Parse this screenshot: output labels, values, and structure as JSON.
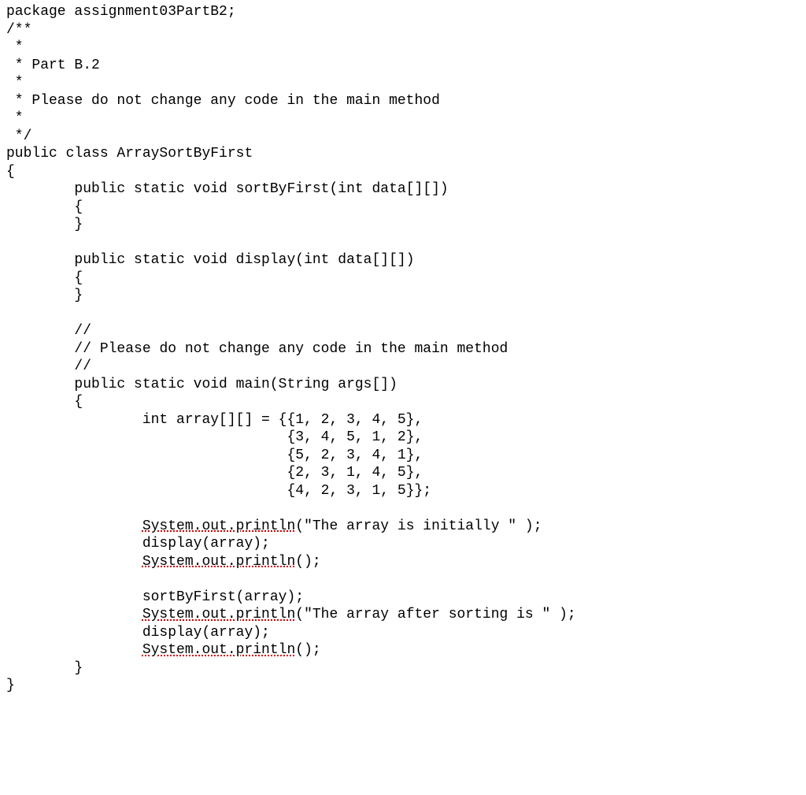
{
  "code": {
    "package_line": "package assignment03PartB2;",
    "javadoc_open": "/**",
    "star": " *",
    "part_line": " * Part B.2",
    "note_line": " * Please do not change any code in the main method",
    "javadoc_close": " */",
    "class_decl": "public class ArraySortByFirst",
    "brace_open": "{",
    "brace_close": "}",
    "indent1": "        ",
    "indent2": "                ",
    "indent_array": "                                 ",
    "sortByFirst_sig": "public static void sortByFirst(int data[][])",
    "display_sig": "public static void display(int data[][])",
    "comment_slashes": "//",
    "main_note": "// Please do not change any code in the main method",
    "main_sig": "public static void main(String args[])",
    "arr_l1": "int array[][] = {{1, 2, 3, 4, 5},",
    "arr_l2": "{3, 4, 5, 1, 2},",
    "arr_l3": "{5, 2, 3, 4, 1},",
    "arr_l4": "{2, 3, 1, 4, 5},",
    "arr_l5": "{4, 2, 3, 1, 5}};",
    "sysout": "System.out.println",
    "print1_arg": "(\"The array is initially \" );",
    "print_empty": "();",
    "display_call": "display(array);",
    "sort_call": "sortByFirst(array);",
    "print2_arg": "(\"The array after sorting is \" );"
  }
}
